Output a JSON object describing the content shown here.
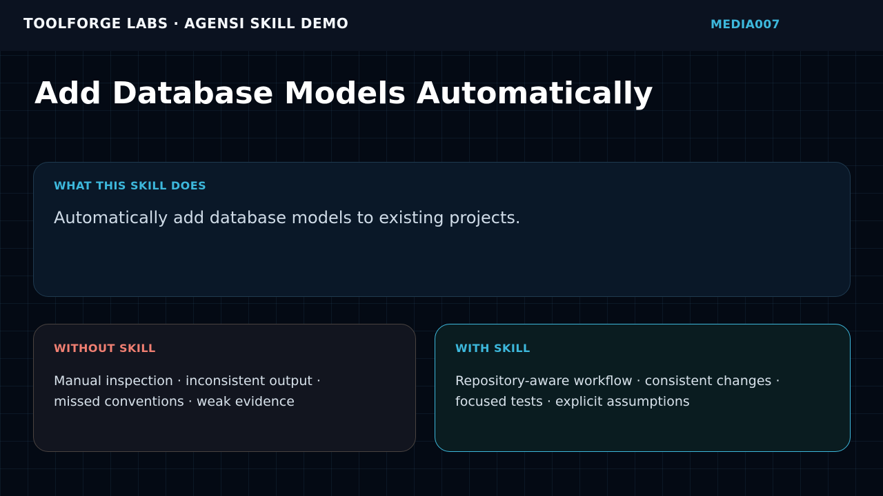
{
  "header": {
    "brand": "TOOLFORGE LABS · AGENSI SKILL DEMO",
    "media_id": "MEDIA007"
  },
  "title": "Add Database Models Automatically",
  "what_card": {
    "label": "WHAT THIS SKILL DOES",
    "body": "Automatically add database models to existing projects."
  },
  "without_card": {
    "label": "WITHOUT SKILL",
    "body": "Manual inspection · inconsistent output · missed conventions · weak evidence"
  },
  "with_card": {
    "label": "WITH SKILL",
    "body": "Repository-aware workflow · consistent changes · focused tests · explicit assumptions"
  },
  "colors": {
    "accent_cyan": "#3db8dc",
    "accent_salmon": "#f07f72",
    "background": "#040a14"
  }
}
